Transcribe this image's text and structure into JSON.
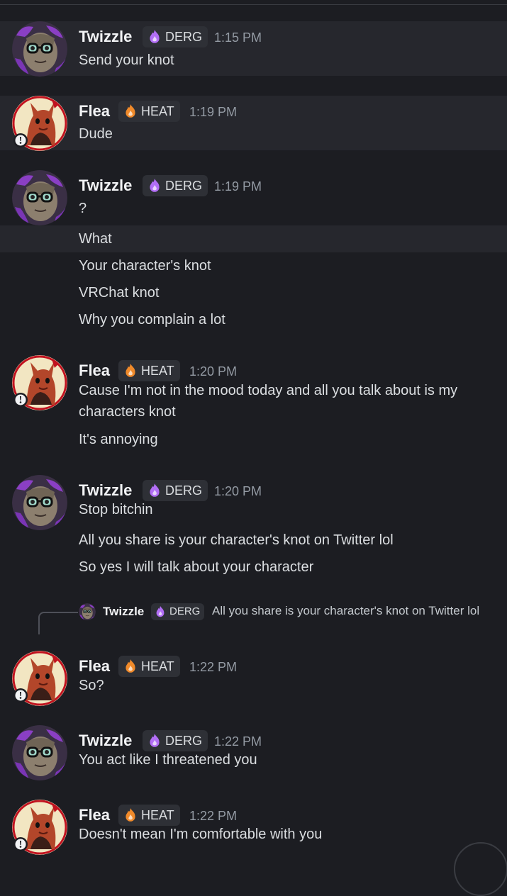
{
  "colors": {
    "background": "#1c1d22",
    "highlight": "#26272d",
    "tag_bg": "#2e3036",
    "timestamp": "#949ba4",
    "text": "#dbdee1"
  },
  "users": {
    "twizzle": {
      "name": "Twizzle",
      "tag": "DERG",
      "tag_icon": "purple-flame-icon"
    },
    "flea": {
      "name": "Flea",
      "tag": "HEAT",
      "tag_icon": "orange-flame-icon"
    }
  },
  "groups": [
    {
      "user": "Twizzle",
      "tag": "DERG",
      "time": "1:15 PM",
      "messages": [
        "Send your knot"
      ]
    },
    {
      "user": "Flea",
      "tag": "HEAT",
      "time": "1:19 PM",
      "messages": [
        "Dude"
      ]
    },
    {
      "user": "Twizzle",
      "tag": "DERG",
      "time": "1:19 PM",
      "messages": [
        "?",
        "What",
        "Your character's knot",
        "VRChat knot",
        "Why you complain a lot"
      ]
    },
    {
      "user": "Flea",
      "tag": "HEAT",
      "time": "1:20 PM",
      "messages": [
        "Cause I'm not in the mood today and all you talk about is my characters knot",
        "It's annoying"
      ]
    },
    {
      "user": "Twizzle",
      "tag": "DERG",
      "time": "1:20 PM",
      "messages": [
        "Stop bitchin",
        "All you share is your character's knot on Twitter lol",
        "So yes I will talk about your character"
      ]
    },
    {
      "user": "Flea",
      "tag": "HEAT",
      "time": "1:22 PM",
      "reply": {
        "user": "Twizzle",
        "tag": "DERG",
        "text": "All you share is your character's knot on Twitter lol"
      },
      "messages": [
        "So?"
      ]
    },
    {
      "user": "Twizzle",
      "tag": "DERG",
      "time": "1:22 PM",
      "messages": [
        "You act like I threatened you"
      ]
    },
    {
      "user": "Flea",
      "tag": "HEAT",
      "time": "1:22 PM",
      "messages": [
        "Doesn't mean I'm comfortable with you"
      ]
    }
  ]
}
